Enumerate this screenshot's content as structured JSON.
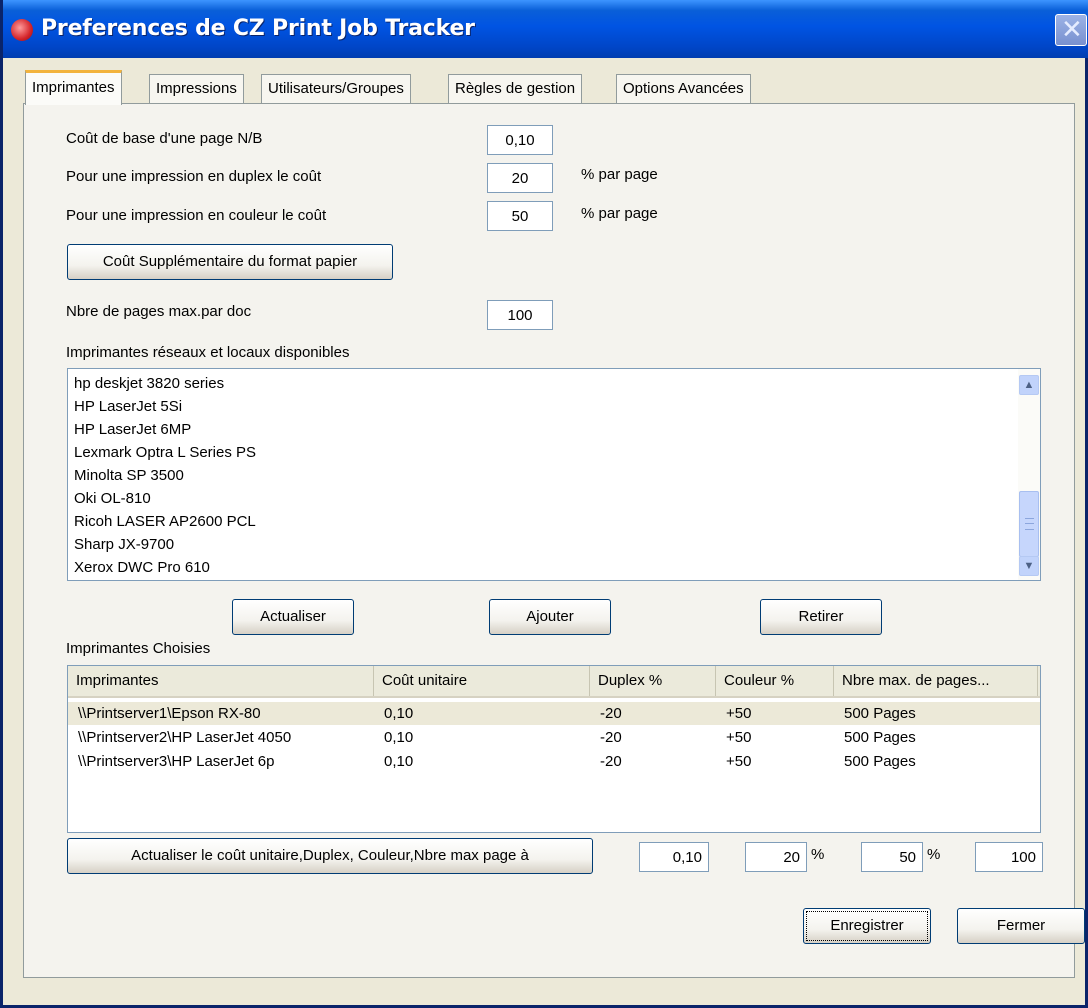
{
  "window": {
    "title": "Preferences de CZ Print Job Tracker"
  },
  "tabs": [
    "Imprimantes",
    "Impressions",
    "Utilisateurs/Groupes",
    "Règles de gestion",
    "Options Avancées"
  ],
  "settings": {
    "base_cost_label": "Coût de base d'une page N/B",
    "base_cost_value": "0,10",
    "duplex_label": "Pour une impression en duplex le coût",
    "duplex_value": "20",
    "duplex_unit": "% par page",
    "color_label": "Pour une impression en couleur le coût",
    "color_value": "50",
    "color_unit": "% par page",
    "paper_button": "Coût Supplémentaire du format papier",
    "max_pages_label": "Nbre de pages max.par doc",
    "max_pages_value": "100"
  },
  "available": {
    "label": "Imprimantes réseaux et locaux disponibles",
    "items": [
      "hp deskjet 3820 series",
      "HP LaserJet 5Si",
      "HP LaserJet 6MP",
      "Lexmark Optra L Series PS",
      "Minolta SP 3500",
      "Oki OL-810",
      "Ricoh LASER AP2600 PCL",
      "Sharp JX-9700",
      "Xerox DWC Pro 610"
    ]
  },
  "actions": {
    "refresh": "Actualiser",
    "add": "Ajouter",
    "remove": "Retirer"
  },
  "chosen": {
    "label": "Imprimantes Choisies",
    "columns": [
      "Imprimantes",
      "Coût unitaire",
      "Duplex %",
      "Couleur %",
      "Nbre max. de pages..."
    ],
    "rows": [
      [
        "\\\\Printserver1\\Epson RX-80",
        "0,10",
        "-20",
        "+50",
        "500 Pages"
      ],
      [
        "\\\\Printserver2\\HP LaserJet 4050",
        "0,10",
        "-20",
        "+50",
        "500 Pages"
      ],
      [
        "\\\\Printserver3\\HP LaserJet 6p",
        "0,10",
        "-20",
        "+50",
        "500 Pages"
      ]
    ]
  },
  "update": {
    "button": "Actualiser le coût unitaire,Duplex, Couleur,Nbre max page à",
    "cost": "0,10",
    "duplex": "20",
    "color": "50",
    "percent": "%",
    "max": "100"
  },
  "footer": {
    "save": "Enregistrer",
    "close": "Fermer"
  }
}
